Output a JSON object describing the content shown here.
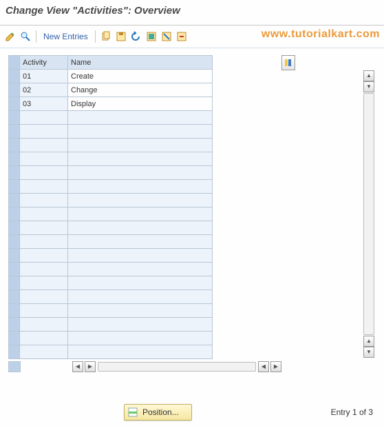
{
  "title": "Change View \"Activities\": Overview",
  "watermark": "www.tutorialkart.com",
  "toolbar": {
    "new_entries": "New Entries"
  },
  "grid": {
    "columns": {
      "activity": "Activity",
      "name": "Name"
    },
    "rows": [
      {
        "activity": "01",
        "name": "Create"
      },
      {
        "activity": "02",
        "name": "Change"
      },
      {
        "activity": "03",
        "name": "Display"
      }
    ],
    "empty_rows": 18
  },
  "footer": {
    "position_label": "Position...",
    "entry_info": "Entry 1 of 3"
  }
}
